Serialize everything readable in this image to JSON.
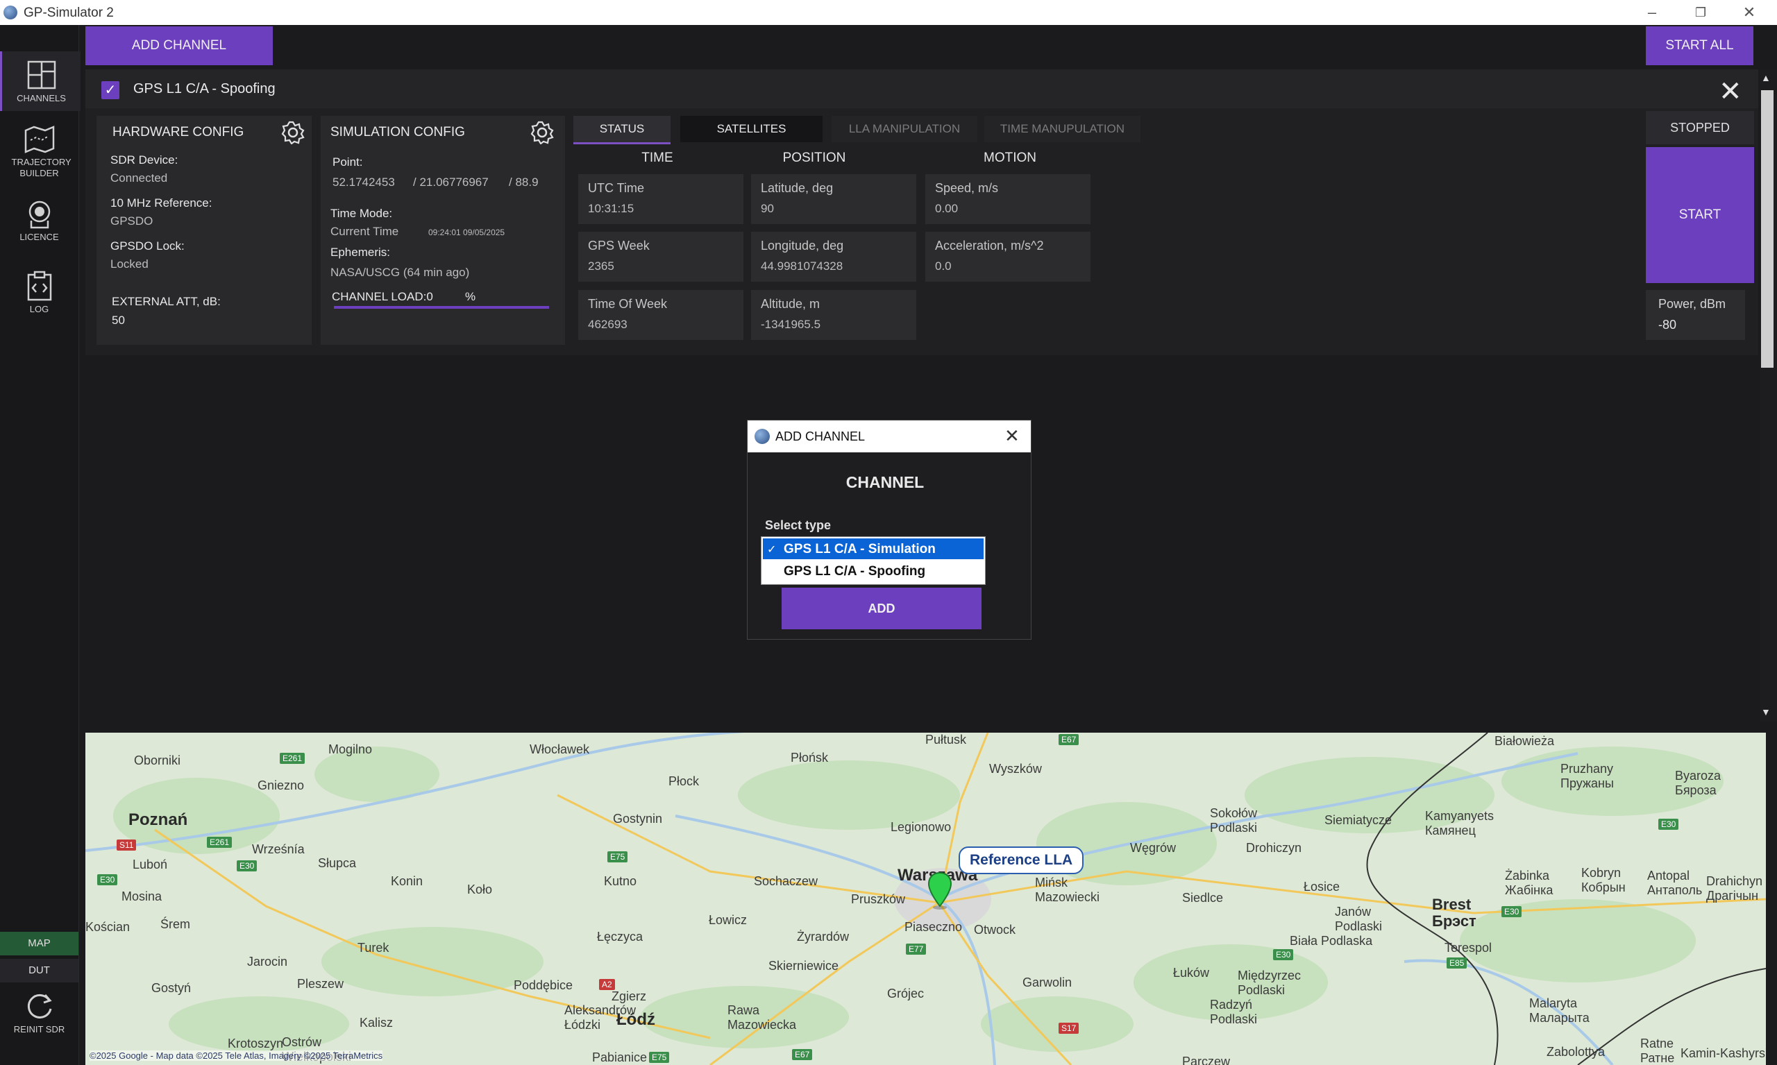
{
  "window": {
    "title": "GP-Simulator 2"
  },
  "leftnav": {
    "items": [
      {
        "label": "CHANNELS",
        "icon": "dashboard-icon"
      },
      {
        "label": "TRAJECTORY BUILDER",
        "icon": "map-route-icon"
      },
      {
        "label": "LICENCE",
        "icon": "licence-badge-icon"
      },
      {
        "label": "LOG",
        "icon": "log-code-icon"
      }
    ],
    "bottom": {
      "map_label": "MAP",
      "dut_label": "DUT",
      "reinit_label": "REINIT SDR"
    }
  },
  "toolbar": {
    "add_channel_label": "ADD CHANNEL",
    "start_all_label": "START ALL"
  },
  "channel": {
    "name": "GPS L1 C/A - Spoofing",
    "enabled": true,
    "hardware": {
      "title": "HARDWARE CONFIG",
      "sdr_label": "SDR Device:",
      "sdr_value": "Connected",
      "ref_label": "10 MHz Reference:",
      "ref_value": "GPSDO",
      "lock_label": "GPSDO Lock:",
      "lock_value": "Locked",
      "att_label": "EXTERNAL ATT, dB:",
      "att_value": "50"
    },
    "simulation": {
      "title": "SIMULATION CONFIG",
      "point_label": "Point:",
      "point_lat": "52.1742453",
      "point_lon": "/ 21.06776967",
      "point_alt": "/ 88.9",
      "time_mode_label": "Time Mode:",
      "time_mode_value": "Current Time",
      "time_mode_stamp": "09:24:01 09/05/2025",
      "ephemeris_label": "Ephemeris:",
      "ephemeris_value": "NASA/USCG (64 min ago)",
      "load_label": "CHANNEL LOAD:0",
      "load_unit": "%"
    },
    "tabs": [
      "STATUS",
      "SATELLITES",
      "LLA MANIPULATION",
      "TIME MANUPULATION"
    ],
    "active_tab": "STATUS",
    "columns": {
      "time": "TIME",
      "position": "POSITION",
      "motion": "MOTION"
    },
    "time_fields": [
      {
        "label": "UTC Time",
        "value": "10:31:15"
      },
      {
        "label": "GPS Week",
        "value": "2365"
      },
      {
        "label": "Time Of Week",
        "value": "462693"
      }
    ],
    "position_fields": [
      {
        "label": "Latitude, deg",
        "value": "90"
      },
      {
        "label": "Longitude, deg",
        "value": "44.9981074328"
      },
      {
        "label": "Altitude, m",
        "value": "-1341965.5"
      }
    ],
    "motion_fields": [
      {
        "label": "Speed, m/s",
        "value": "0.00"
      },
      {
        "label": "Acceleration, m/s^2",
        "value": "0.0"
      }
    ],
    "status": "STOPPED",
    "start_label": "START",
    "power_label": "Power, dBm",
    "power_value": "-80"
  },
  "modal": {
    "title": "ADD CHANNEL",
    "heading": "CHANNEL",
    "select_label": "Select type",
    "options": [
      "GPS L1 C/A - Simulation",
      "GPS L1 C/A - Spoofing"
    ],
    "selected_mark": "✓",
    "add_label": "ADD"
  },
  "map": {
    "marker_label": "Reference LLA",
    "attribution": "©2025 Google - Map data ©2025 Tele Atlas, Imagery ©2025 TerraMetrics",
    "places_major": [
      "Poznań",
      "Warszawa",
      "Łódź",
      "Brest Брэст"
    ],
    "places": [
      "Oborniki",
      "Gniezno",
      "Mogilno",
      "Włocławek",
      "Płock",
      "Płońsk",
      "Pułtusk",
      "Wyszków",
      "Białowieża",
      "Pruzhany Пружаны",
      "Byaroza Бяроза",
      "Wrześnía",
      "Słupca",
      "Konin",
      "Koło",
      "Kutno",
      "Gostynin",
      "Legionowo",
      "Sochaczew",
      "Pruszków",
      "Mińsk Mazowiecki",
      "Węgrów",
      "Sokołów Podlaski",
      "Siemiatycze",
      "Drohiczyn",
      "Kamyanyets Камянец",
      "Siedlce",
      "Łosice",
      "Janów Podlaski",
      "Biała Podlaska",
      "Terespol",
      "Luboń",
      "Mosina",
      "Kościan",
      "Śrem",
      "Jarocin",
      "Turek",
      "Łęczyca",
      "Łowicz",
      "Żyrardów",
      "Piaseczno",
      "Otwock",
      "Skierniewice",
      "Grójec",
      "Garwolin",
      "Łuków",
      "Międzyrzec Podlaski",
      "Radzyń Podlaski",
      "Gostyń",
      "Pleszew",
      "Kalisz",
      "Poddębice",
      "Zgierz",
      "Aleksandrów Łódzki",
      "Rawa Mazowiecka",
      "Krotoszyn",
      "Ostrów Wielkopolski",
      "Pabianice",
      "Żabinka Жабінка",
      "Kobryn Кобрын",
      "Antopal Антаполь",
      "Drahichyn Драгічын",
      "Malaryta Маларыта",
      "Ratne Ратне",
      "Zabolottya",
      "Kamin-Kashyrs'kyi",
      "Parczew"
    ],
    "roads": [
      "E261",
      "S11",
      "E261",
      "E30",
      "E30",
      "E75",
      "A2",
      "E67",
      "E77",
      "E30",
      "E85",
      "S17",
      "E30",
      "E67",
      "E75",
      "E30"
    ]
  }
}
